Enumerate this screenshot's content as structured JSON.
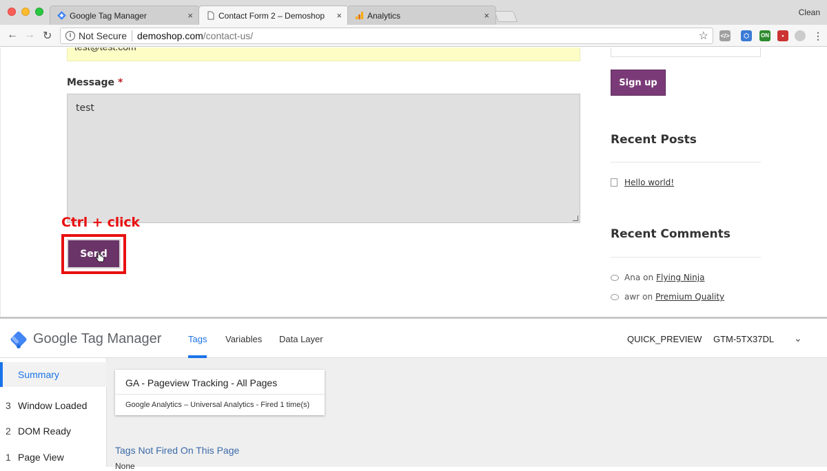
{
  "browser": {
    "tabs": [
      {
        "label": "Google Tag Manager",
        "close": "×"
      },
      {
        "label": "Contact Form 2 – Demoshop",
        "close": "×"
      },
      {
        "label": "Analytics",
        "close": "×"
      }
    ],
    "profile_label": "Clean",
    "address": {
      "security": "Not Secure",
      "host": "demoshop.com",
      "path": "/contact-us/"
    },
    "extensions": [
      {
        "icon": "code-icon",
        "color": "#9a9a9a"
      },
      {
        "icon": "tag-assistant-icon",
        "color": "#3a7bd5"
      },
      {
        "icon": "ga-debugger-on-icon",
        "color": "#2e8b2e",
        "label": "ON"
      },
      {
        "icon": "flag-icon",
        "color": "#c33"
      },
      {
        "icon": "ghostery-icon",
        "color": "#bbb"
      },
      {
        "icon": "menu-icon",
        "color": "#666"
      }
    ]
  },
  "page": {
    "email_value": "test@test.com",
    "message_label": "Message",
    "required_mark": "*",
    "message_value": "test",
    "annotation": "Ctrl + click",
    "send_label": "Send",
    "signup_label": "Sign up",
    "recent_posts_heading": "Recent Posts",
    "posts": [
      "Hello world!"
    ],
    "recent_comments_heading": "Recent Comments",
    "comments": [
      {
        "author": "Ana",
        "on": "on",
        "post": "Flying Ninja"
      },
      {
        "author": "awr",
        "on": "on",
        "post": "Premium Quality"
      }
    ]
  },
  "gtm": {
    "brand": "Google Tag Manager",
    "tabs": [
      "Tags",
      "Variables",
      "Data Layer"
    ],
    "active_tab": "Tags",
    "mode": "QUICK_PREVIEW",
    "container_id": "GTM-5TX37DL",
    "summary_label": "Summary",
    "events": [
      {
        "num": "3",
        "label": "Window Loaded"
      },
      {
        "num": "2",
        "label": "DOM Ready"
      },
      {
        "num": "1",
        "label": "Page View"
      }
    ],
    "fired_tag": {
      "name": "GA - Pageview Tracking - All Pages",
      "meta": "Google Analytics – Universal Analytics - Fired 1 time(s)"
    },
    "not_fired_heading": "Tags Not Fired On This Page",
    "not_fired_value": "None",
    "accent_color": "#1a73e8"
  }
}
